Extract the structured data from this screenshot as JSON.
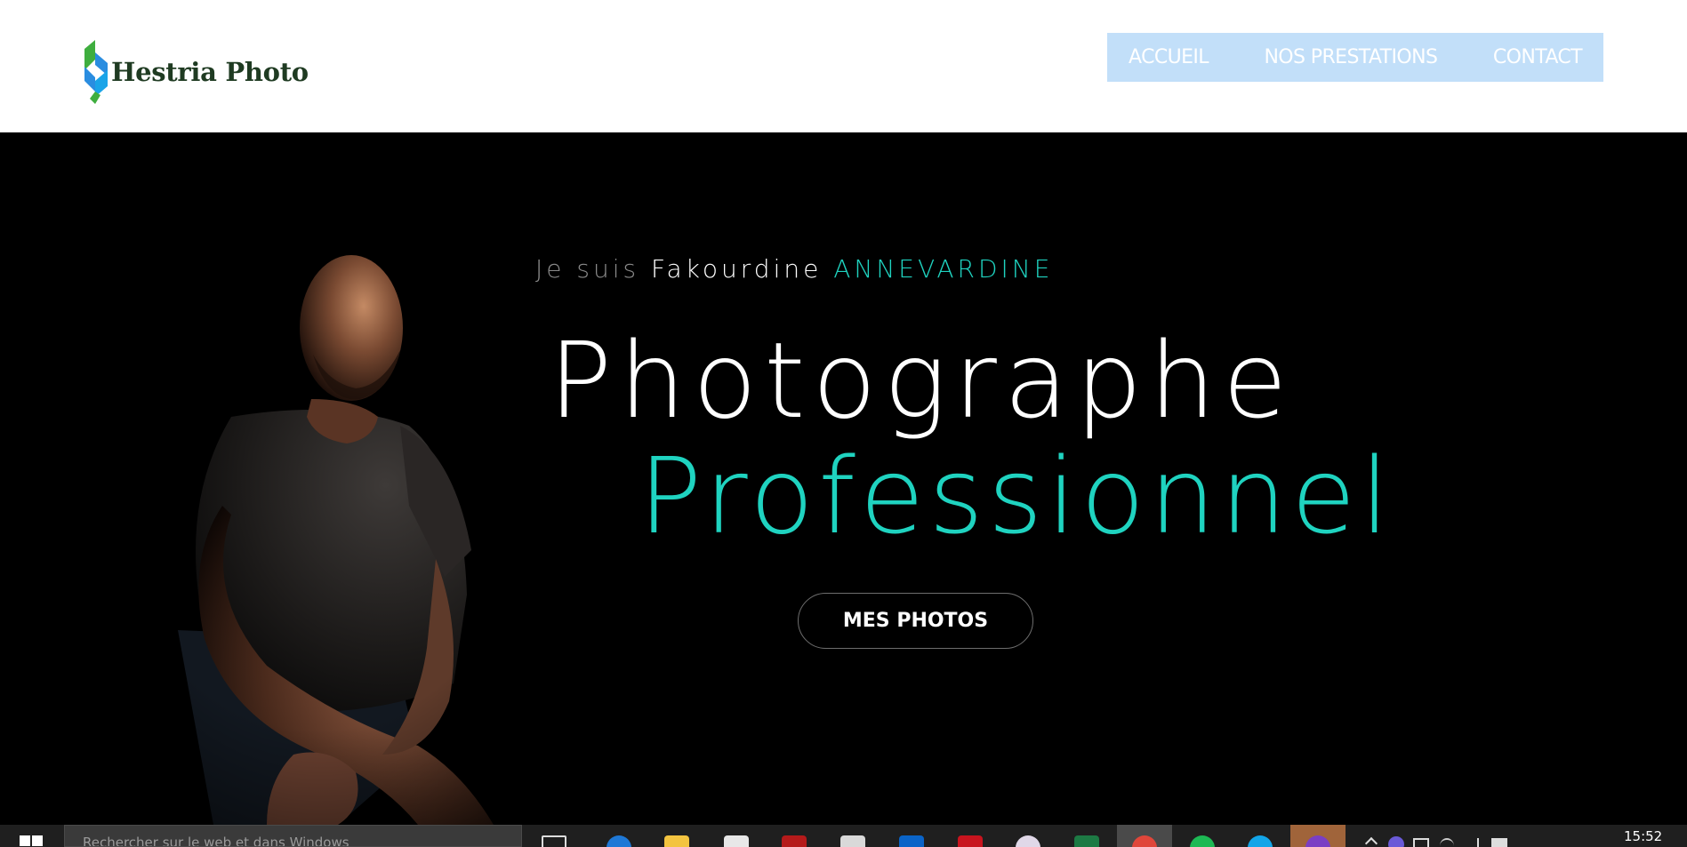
{
  "header": {
    "logo_text": "Hestria Photo",
    "nav": [
      {
        "label": "ACCUEIL"
      },
      {
        "label": "NOS PRESTATIONS"
      },
      {
        "label": "CONTACT"
      }
    ],
    "nav_background": "#c2dff9"
  },
  "hero": {
    "intro_prefix": "Je suis",
    "intro_first_name": "Fakourdine",
    "intro_last_name": "ANNEVARDINE",
    "headline_line1": "Photographe",
    "headline_line2": "Professionnel",
    "cta_label": "MES PHOTOS",
    "accent_color": "#1fd3c0"
  },
  "taskbar": {
    "search_placeholder": "Rechercher sur le web et dans Windows",
    "clock_time": "15:52",
    "apps": [
      {
        "icon": "task-view-icon"
      },
      {
        "icon": "edge-icon"
      },
      {
        "icon": "file-explorer-icon"
      },
      {
        "icon": "store-icon"
      },
      {
        "icon": "camera-app-icon"
      },
      {
        "icon": "calculator-icon"
      },
      {
        "icon": "outlook-icon"
      },
      {
        "icon": "flash-icon"
      },
      {
        "icon": "paint-icon"
      },
      {
        "icon": "excel-icon"
      },
      {
        "icon": "chrome-icon"
      },
      {
        "icon": "spotify-icon"
      },
      {
        "icon": "skype-icon"
      },
      {
        "icon": "visual-studio-icon"
      }
    ]
  }
}
